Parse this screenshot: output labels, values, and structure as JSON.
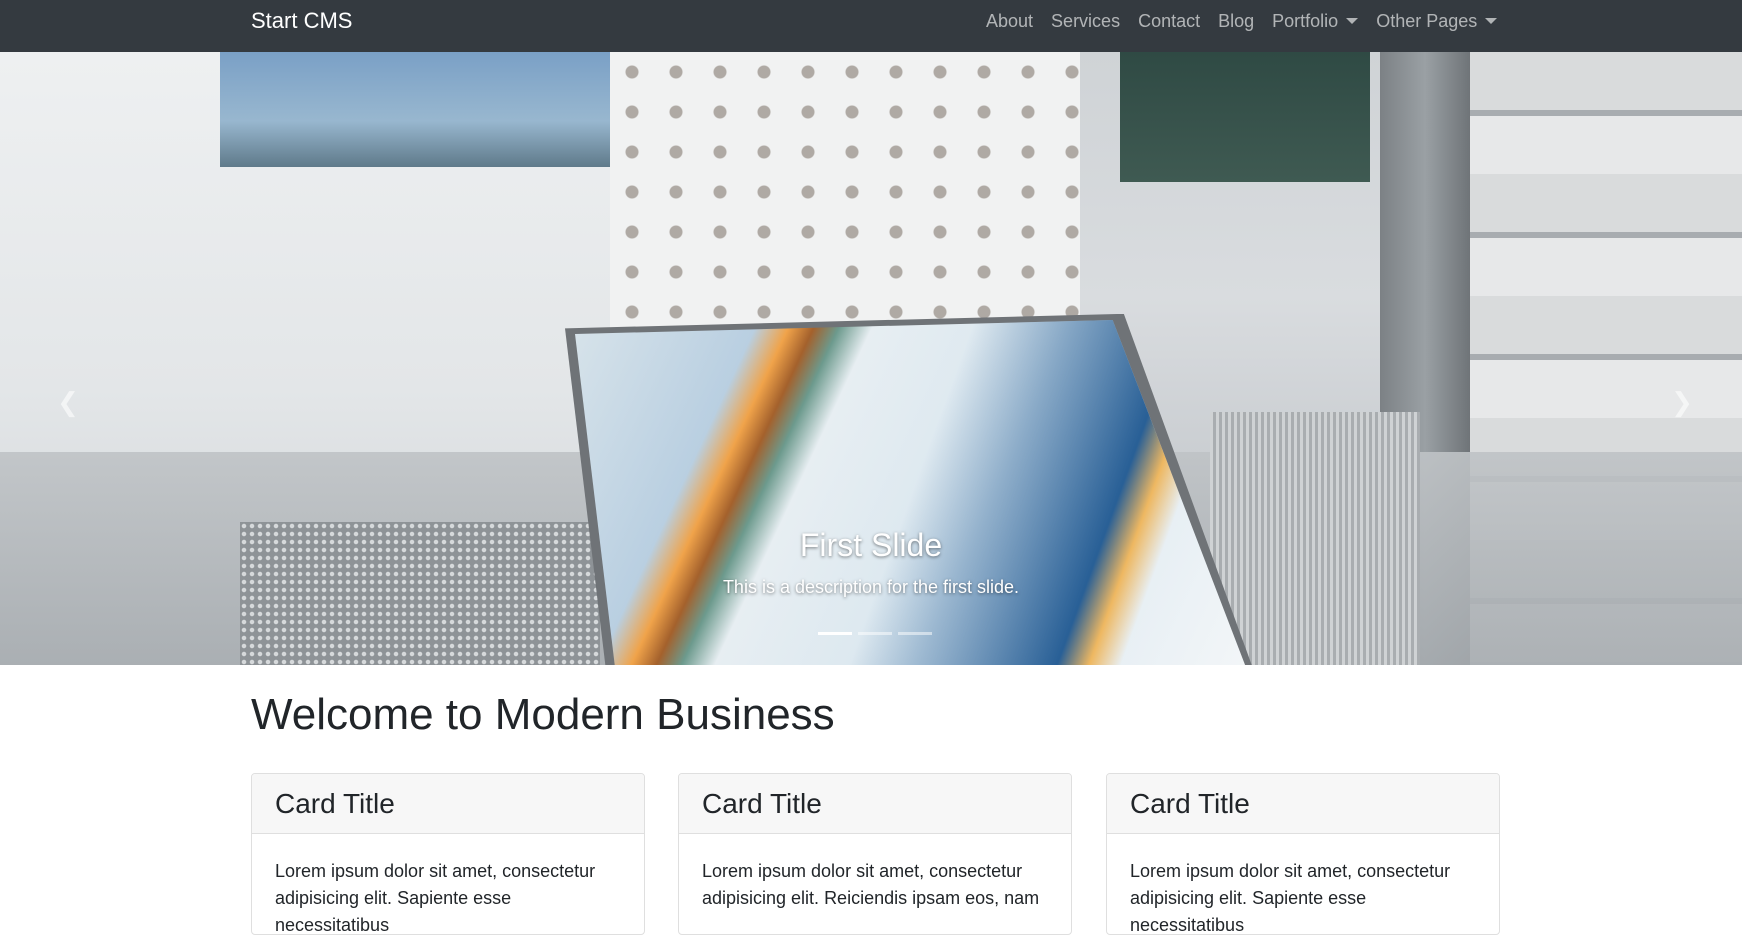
{
  "navbar": {
    "brand": "Start CMS",
    "links": [
      {
        "label": "About"
      },
      {
        "label": "Services"
      },
      {
        "label": "Contact"
      },
      {
        "label": "Blog"
      },
      {
        "label": "Portfolio",
        "dropdown": true
      },
      {
        "label": "Other Pages",
        "dropdown": true
      }
    ]
  },
  "carousel": {
    "caption_title": "First Slide",
    "caption_text": "This is a description for the first slide.",
    "active_index": 0,
    "slides": 3,
    "prev_icon": "chevron-left-icon",
    "next_icon": "chevron-right-icon"
  },
  "main": {
    "title": "Welcome to Modern Business",
    "cards": [
      {
        "title": "Card Title",
        "text": "Lorem ipsum dolor sit amet, consectetur adipisicing elit. Sapiente esse necessitatibus"
      },
      {
        "title": "Card Title",
        "text": "Lorem ipsum dolor sit amet, consectetur adipisicing elit. Reiciendis ipsam eos, nam"
      },
      {
        "title": "Card Title",
        "text": "Lorem ipsum dolor sit amet, consectetur adipisicing elit. Sapiente esse necessitatibus"
      }
    ]
  },
  "colors": {
    "navbar_bg": "#343a40",
    "nav_link": "rgba(255,255,255,0.62)",
    "text": "#212529",
    "card_header_bg": "#f7f7f7"
  }
}
